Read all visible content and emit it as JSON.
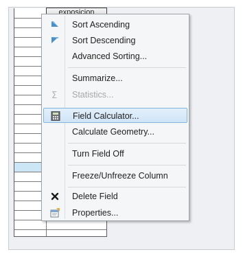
{
  "table": {
    "column_header": "exposicion"
  },
  "menu": {
    "items": [
      {
        "label": "Sort Ascending",
        "icon": "sort-ascending-icon",
        "enabled": true
      },
      {
        "label": "Sort Descending",
        "icon": "sort-descending-icon",
        "enabled": true
      },
      {
        "label": "Advanced Sorting...",
        "icon": "",
        "enabled": true
      },
      {
        "label": "Summarize...",
        "icon": "",
        "enabled": true
      },
      {
        "label": "Statistics...",
        "icon": "sigma-icon",
        "enabled": false
      },
      {
        "label": "Field Calculator...",
        "icon": "calculator-icon",
        "enabled": true,
        "highlighted": true
      },
      {
        "label": "Calculate Geometry...",
        "icon": "",
        "enabled": true
      },
      {
        "label": "Turn Field Off",
        "icon": "",
        "enabled": true
      },
      {
        "label": "Freeze/Unfreeze Column",
        "icon": "",
        "enabled": true
      },
      {
        "label": "Delete Field",
        "icon": "delete-x-icon",
        "enabled": true
      },
      {
        "label": "Properties...",
        "icon": "properties-icon",
        "enabled": true
      }
    ]
  },
  "colors": {
    "highlight": "#cfe4f7",
    "highlight_border": "#86b3dc",
    "selected_row": "#cde6f6",
    "sort_icon": "#4a90c8"
  }
}
